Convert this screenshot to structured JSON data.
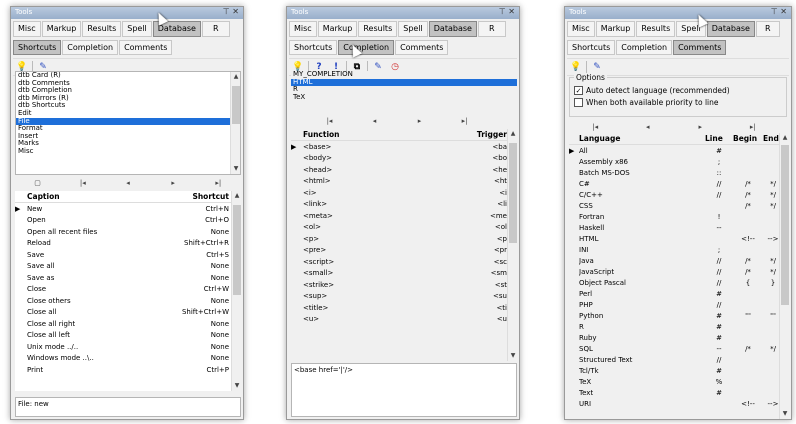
{
  "window_title": "Tools",
  "main_tabs": [
    "Misc",
    "Markup",
    "Results",
    "Spell",
    "Database",
    "R"
  ],
  "sub_tabs": [
    "Shortcuts",
    "Completion",
    "Comments"
  ],
  "panel1": {
    "list_items": [
      "dtb Card (R)",
      "dtb Comments",
      "dtb Completion",
      "dtb Mirrors (R)",
      "dtb Shortcuts",
      "Edit",
      "File",
      "Format",
      "Insert",
      "Marks",
      "Misc"
    ],
    "selected_index": 6,
    "nav": [
      "|◂",
      "◂",
      "▸",
      "▸|"
    ],
    "grid_headers": [
      "Caption",
      "Shortcut"
    ],
    "rows": [
      {
        "caption": "New",
        "shortcut": "Ctrl+N"
      },
      {
        "caption": "Open",
        "shortcut": "Ctrl+O"
      },
      {
        "caption": "Open all recent files",
        "shortcut": "None"
      },
      {
        "caption": "Reload",
        "shortcut": "Shift+Ctrl+R"
      },
      {
        "caption": "Save",
        "shortcut": "Ctrl+S"
      },
      {
        "caption": "Save all",
        "shortcut": "None"
      },
      {
        "caption": "Save as",
        "shortcut": "None"
      },
      {
        "caption": "Close",
        "shortcut": "Ctrl+W"
      },
      {
        "caption": "Close others",
        "shortcut": "None"
      },
      {
        "caption": "Close all",
        "shortcut": "Shift+Ctrl+W"
      },
      {
        "caption": "Close all right",
        "shortcut": "None"
      },
      {
        "caption": "Close all left",
        "shortcut": "None"
      },
      {
        "caption": "Unix mode ../..",
        "shortcut": "None"
      },
      {
        "caption": "Windows mode ..\\..",
        "shortcut": "None"
      },
      {
        "caption": "Print",
        "shortcut": "Ctrl+P"
      }
    ],
    "memo": "File: new"
  },
  "panel2": {
    "list_items": [
      "MY_COMPLETION",
      "HTML",
      "R",
      "TeX"
    ],
    "selected_index": 1,
    "nav": [
      "|◂",
      "◂",
      "▸",
      "▸|"
    ],
    "grid_headers": [
      "Function",
      "Trigger"
    ],
    "rows": [
      {
        "f": "<base>",
        "t": "<ba"
      },
      {
        "f": "<body>",
        "t": "<bo"
      },
      {
        "f": "<head>",
        "t": "<he"
      },
      {
        "f": "<html>",
        "t": "<ht"
      },
      {
        "f": "<i>",
        "t": "<i"
      },
      {
        "f": "<link>",
        "t": "<li"
      },
      {
        "f": "<meta>",
        "t": "<me"
      },
      {
        "f": "<ol>",
        "t": "<ol"
      },
      {
        "f": "<p>",
        "t": "<p"
      },
      {
        "f": "<pre>",
        "t": "<pr"
      },
      {
        "f": "<script>",
        "t": "<sc"
      },
      {
        "f": "<small>",
        "t": "<sm"
      },
      {
        "f": "<strike>",
        "t": "<st"
      },
      {
        "f": "<sup>",
        "t": "<su"
      },
      {
        "f": "<title>",
        "t": "<ti"
      },
      {
        "f": "<u>",
        "t": "<u"
      }
    ],
    "memo": "<base href='|'/>"
  },
  "panel3": {
    "options_title": "Options",
    "opt1": "Auto detect language (recommended)",
    "opt2": "When both available priority to line",
    "nav": [
      "|◂",
      "◂",
      "▸",
      "▸|"
    ],
    "grid_headers": [
      "Language",
      "Line",
      "Begin",
      "End"
    ],
    "rows": [
      {
        "lang": "All",
        "line": "#",
        "begin": "",
        "end": ""
      },
      {
        "lang": "Assembly x86",
        "line": ";",
        "begin": "",
        "end": ""
      },
      {
        "lang": "Batch MS-DOS",
        "line": "::",
        "begin": "",
        "end": ""
      },
      {
        "lang": "C#",
        "line": "//",
        "begin": "/*",
        "end": "*/"
      },
      {
        "lang": "C/C++",
        "line": "//",
        "begin": "/*",
        "end": "*/"
      },
      {
        "lang": "CSS",
        "line": "",
        "begin": "/*",
        "end": "*/"
      },
      {
        "lang": "Fortran",
        "line": "!",
        "begin": "",
        "end": ""
      },
      {
        "lang": "Haskell",
        "line": "--",
        "begin": "",
        "end": ""
      },
      {
        "lang": "HTML",
        "line": "",
        "begin": "<!--",
        "end": "-->"
      },
      {
        "lang": "INI",
        "line": ";",
        "begin": "",
        "end": ""
      },
      {
        "lang": "Java",
        "line": "//",
        "begin": "/*",
        "end": "*/"
      },
      {
        "lang": "JavaScript",
        "line": "//",
        "begin": "/*",
        "end": "*/"
      },
      {
        "lang": "Object Pascal",
        "line": "//",
        "begin": "{",
        "end": "}"
      },
      {
        "lang": "Perl",
        "line": "#",
        "begin": "",
        "end": ""
      },
      {
        "lang": "PHP",
        "line": "//",
        "begin": "",
        "end": ""
      },
      {
        "lang": "Python",
        "line": "#",
        "begin": "'''",
        "end": "'''"
      },
      {
        "lang": "R",
        "line": "#",
        "begin": "",
        "end": ""
      },
      {
        "lang": "Ruby",
        "line": "#",
        "begin": "",
        "end": ""
      },
      {
        "lang": "SQL",
        "line": "--",
        "begin": "/*",
        "end": "*/"
      },
      {
        "lang": "Structured Text",
        "line": "//",
        "begin": "",
        "end": ""
      },
      {
        "lang": "Tcl/Tk",
        "line": "#",
        "begin": "",
        "end": ""
      },
      {
        "lang": "TeX",
        "line": "%",
        "begin": "",
        "end": ""
      },
      {
        "lang": "Text",
        "line": "#",
        "begin": "",
        "end": ""
      },
      {
        "lang": "URI",
        "line": "",
        "begin": "<!--",
        "end": "-->"
      }
    ]
  },
  "colors": {
    "selection": "#1e6fd9",
    "active_tab": "#c2c2c2",
    "titlebar": "#99afcb"
  },
  "icons": [
    "bulb-icon",
    "pen-icon",
    "help-icon",
    "exclamation-icon",
    "copy-icon",
    "clock-icon"
  ]
}
